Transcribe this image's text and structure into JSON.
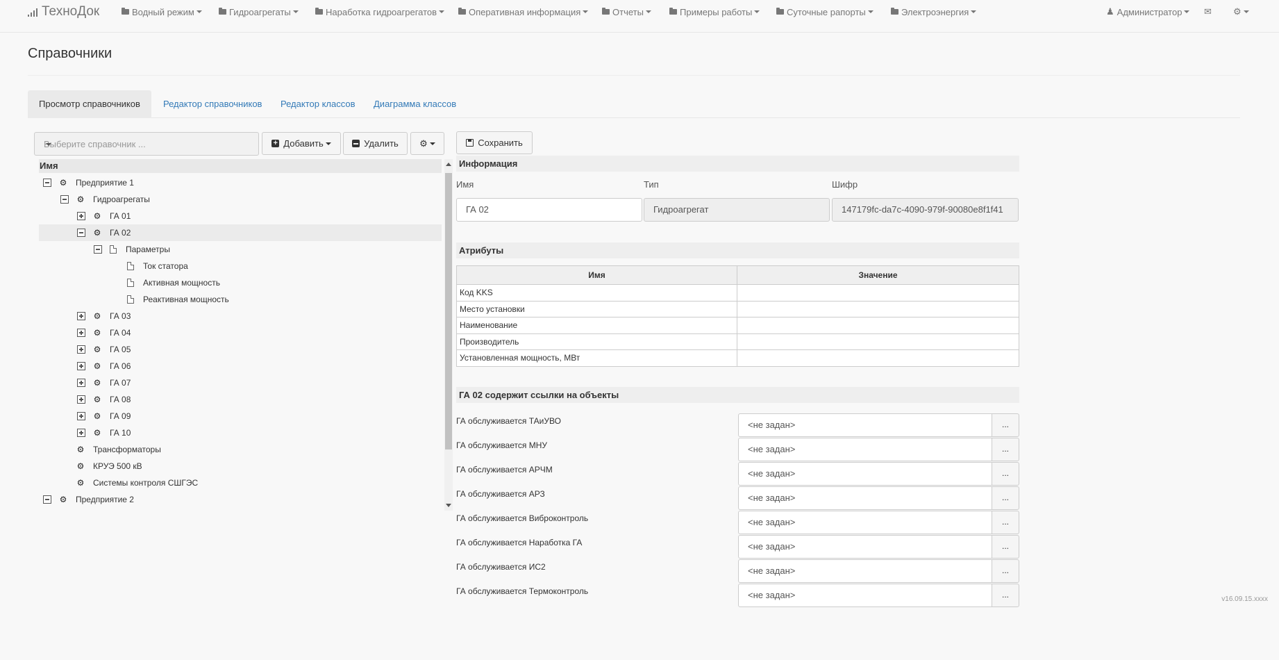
{
  "navbar": {
    "brand": "ТехноДок",
    "items": [
      {
        "label": "Водный режим",
        "icon": "folder-icon"
      },
      {
        "label": "Гидроагрегаты",
        "icon": "folder-icon"
      },
      {
        "label": "Наработка гидроагрегатов",
        "icon": "folder-icon"
      },
      {
        "label": "Оперативная информация",
        "icon": "folder-icon"
      },
      {
        "label": "Отчеты",
        "icon": "folder-icon"
      },
      {
        "label": "Примеры работы",
        "icon": "folder-icon"
      },
      {
        "label": "Суточные рапорты",
        "icon": "folder-icon"
      },
      {
        "label": "Электроэнергия",
        "icon": "folder-icon"
      }
    ],
    "user": "Администратор",
    "mail_icon": "envelope-icon",
    "settings_icon": "gear-icon"
  },
  "page": {
    "title": "Справочники"
  },
  "tabs": [
    {
      "label": "Просмотр справочников",
      "active": true
    },
    {
      "label": "Редактор справочников",
      "active": false
    },
    {
      "label": "Редактор классов",
      "active": false
    },
    {
      "label": "Диаграмма классов",
      "active": false
    }
  ],
  "toolbar": {
    "select_placeholder": "Выберите справочник ...",
    "add_label": "Добавить",
    "delete_label": "Удалить",
    "save_label": "Сохранить"
  },
  "tree": {
    "header": "Имя",
    "rows": [
      {
        "label": "Предприятие 1",
        "level": 0,
        "expander": "minus",
        "icon": "gear-icon"
      },
      {
        "label": "Гидроагрегаты",
        "level": 1,
        "expander": "minus",
        "icon": "gear-icon"
      },
      {
        "label": "ГА 01",
        "level": 2,
        "expander": "plus",
        "icon": "gear-icon"
      },
      {
        "label": "ГА 02",
        "level": 2,
        "expander": "minus",
        "icon": "gear-icon",
        "selected": true
      },
      {
        "label": "Параметры",
        "level": 3,
        "expander": "minus",
        "icon": "document-icon"
      },
      {
        "label": "Ток статора",
        "level": 4,
        "expander": "none",
        "icon": "document-icon"
      },
      {
        "label": "Активная мощность",
        "level": 4,
        "expander": "none",
        "icon": "document-icon"
      },
      {
        "label": "Реактивная мощность",
        "level": 4,
        "expander": "none",
        "icon": "document-icon"
      },
      {
        "label": "ГА 03",
        "level": 2,
        "expander": "plus",
        "icon": "gear-icon"
      },
      {
        "label": "ГА 04",
        "level": 2,
        "expander": "plus",
        "icon": "gear-icon"
      },
      {
        "label": "ГА 05",
        "level": 2,
        "expander": "plus",
        "icon": "gear-icon"
      },
      {
        "label": "ГА 06",
        "level": 2,
        "expander": "plus",
        "icon": "gear-icon"
      },
      {
        "label": "ГА 07",
        "level": 2,
        "expander": "plus",
        "icon": "gear-icon"
      },
      {
        "label": "ГА 08",
        "level": 2,
        "expander": "plus",
        "icon": "gear-icon"
      },
      {
        "label": "ГА 09",
        "level": 2,
        "expander": "plus",
        "icon": "gear-icon"
      },
      {
        "label": "ГА 10",
        "level": 2,
        "expander": "plus",
        "icon": "gear-icon"
      },
      {
        "label": "Трансформаторы",
        "level": 1,
        "expander": "none",
        "icon": "gear-icon"
      },
      {
        "label": "КРУЭ 500 кВ",
        "level": 1,
        "expander": "none",
        "icon": "gear-icon"
      },
      {
        "label": "Системы контроля СШГЭС",
        "level": 1,
        "expander": "none",
        "icon": "gear-icon"
      },
      {
        "label": "Предприятие 2",
        "level": 0,
        "expander": "minus",
        "icon": "gear-icon"
      }
    ]
  },
  "info": {
    "heading": "Информация",
    "name_label": "Имя",
    "type_label": "Тип",
    "code_label": "Шифр",
    "name_value": "ГА 02",
    "type_value": "Гидроагрегат",
    "code_value": "147179fc-da7c-4090-979f-90080e8f1f41"
  },
  "attributes": {
    "heading": "Атрибуты",
    "columns": [
      "Имя",
      "Значение"
    ],
    "rows": [
      {
        "name": "Код KKS",
        "value": ""
      },
      {
        "name": "Место установки",
        "value": ""
      },
      {
        "name": "Наименование",
        "value": ""
      },
      {
        "name": "Производитель",
        "value": ""
      },
      {
        "name": "Установленная мощность, МВт",
        "value": ""
      }
    ]
  },
  "links": {
    "heading": "ГА 02 содержит ссылки на объекты",
    "button_label": "...",
    "rows": [
      {
        "label": "ГА обслуживается ТАиУВО",
        "value": "<не задан>"
      },
      {
        "label": "ГА обслуживается МНУ",
        "value": "<не задан>"
      },
      {
        "label": "ГА обслуживается АРЧМ",
        "value": "<не задан>"
      },
      {
        "label": "ГА обслуживается АРЗ",
        "value": "<не задан>"
      },
      {
        "label": "ГА обслуживается Виброконтроль",
        "value": "<не задан>"
      },
      {
        "label": "ГА обслуживается Наработка ГА",
        "value": "<не задан>"
      },
      {
        "label": "ГА обслуживается ИС2",
        "value": "<не задан>"
      },
      {
        "label": "ГА обслуживается Термоконтроль",
        "value": "<не задан>"
      }
    ]
  },
  "footer": {
    "version": "v16.09.15.xxxx"
  }
}
